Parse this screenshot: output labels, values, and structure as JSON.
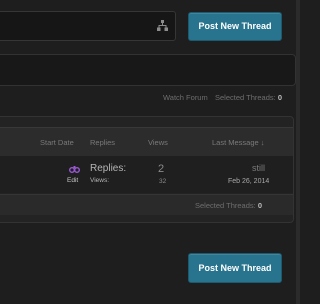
{
  "colors": {
    "accent": "#28738d",
    "moderate_icon": "#9b59d6"
  },
  "search_field": {
    "value": "",
    "icon": "sitemap-icon"
  },
  "actions": {
    "post_top": "Post New Thread",
    "post_bottom": "Post New Thread"
  },
  "controls": {
    "watch_forum": "Watch Forum",
    "selected_label": "Selected Threads:",
    "selected_count": "0"
  },
  "columns": {
    "start_date": "Start Date",
    "replies": "Replies",
    "views": "Views",
    "last_message": "Last Message ↓"
  },
  "thread": {
    "edit": "Edit",
    "replies_label": "Replies:",
    "views_label": "Views:",
    "reply_count": "2",
    "view_count": "32",
    "last_user": "still",
    "last_date": "Feb 26, 2014"
  },
  "footer": {
    "selected_label": "Selected Threads:",
    "selected_count": "0"
  }
}
